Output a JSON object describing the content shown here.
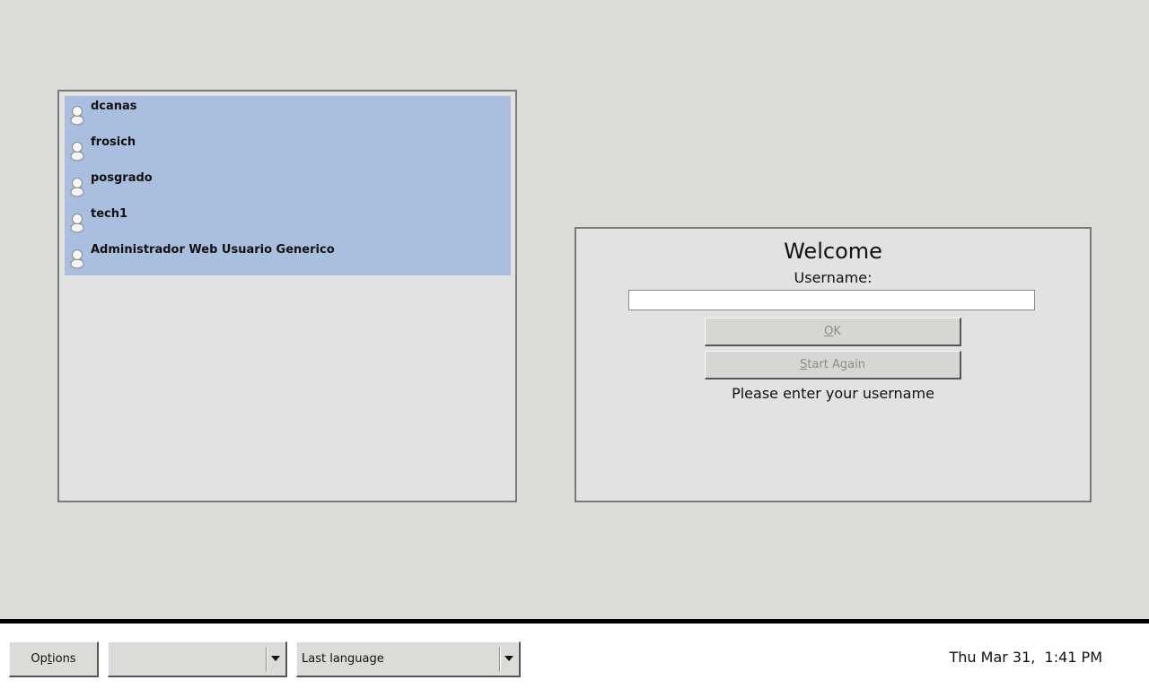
{
  "user_list": {
    "users": [
      {
        "name": "dcanas",
        "icon": "user-icon"
      },
      {
        "name": "frosich",
        "icon": "user-icon"
      },
      {
        "name": "posgrado",
        "icon": "user-icon"
      },
      {
        "name": "tech1",
        "icon": "user-icon"
      },
      {
        "name": "Administrador Web Usuario Generico",
        "icon": "user-icon"
      }
    ],
    "selection_color": "#aabfdf"
  },
  "login": {
    "welcome": "Welcome",
    "username_label": "Username:",
    "username_value": "",
    "ok_mnemonic": "O",
    "ok_rest": "K",
    "start_again_mnemonic": "S",
    "start_again_rest": "tart Again",
    "message": "Please enter your username"
  },
  "bottom_bar": {
    "options_pre": "Op",
    "options_mnemonic": "t",
    "options_post": "ions",
    "session_value": "",
    "language_value": "Last language",
    "clock": "Thu Mar 31,  1:41 PM"
  }
}
